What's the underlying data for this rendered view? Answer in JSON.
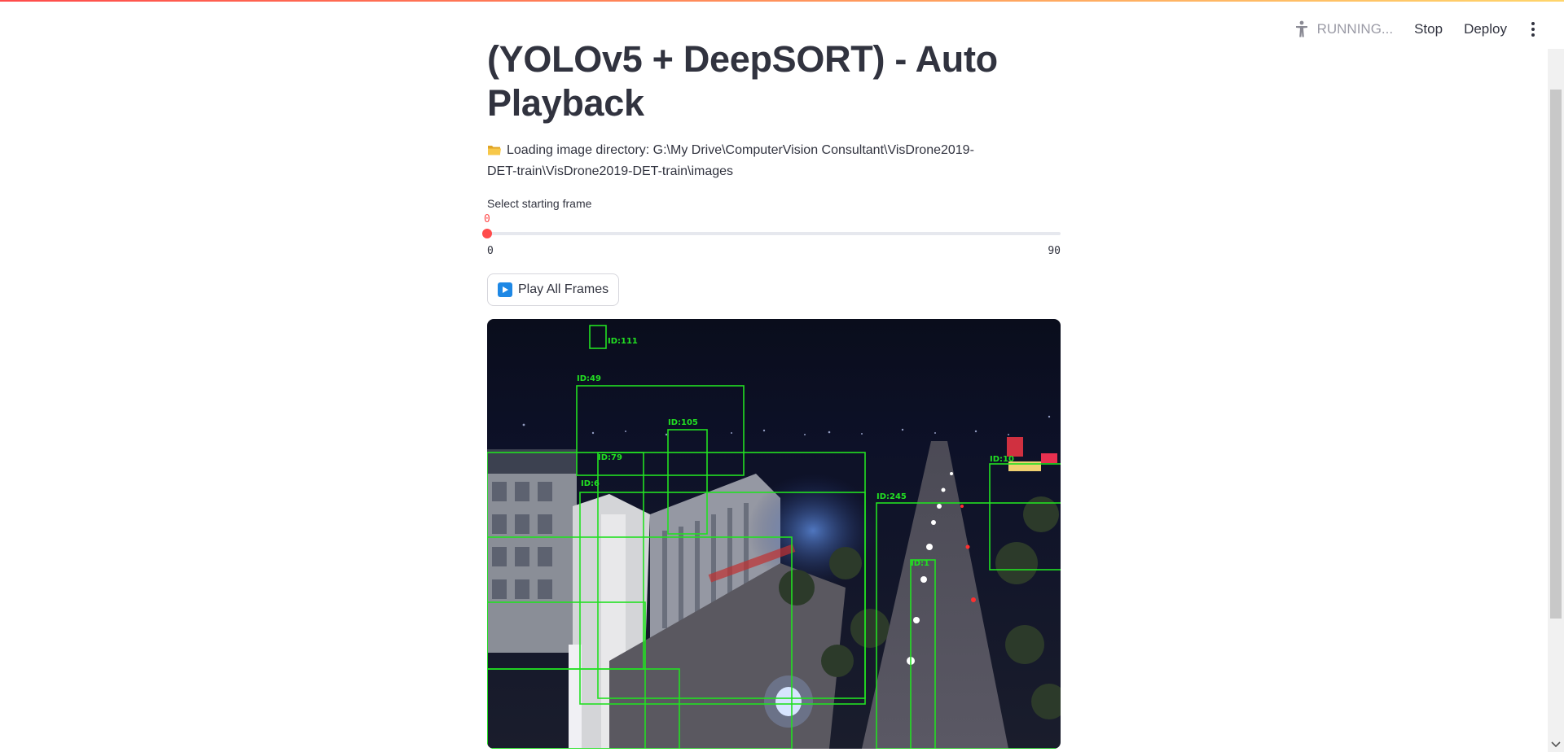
{
  "toolbar": {
    "status": "RUNNING...",
    "stop_label": "Stop",
    "deploy_label": "Deploy"
  },
  "main": {
    "title": "(YOLOv5 + DeepSORT) - Auto Playback",
    "directory_text": "Loading image directory: G:\\My Drive\\ComputerVision Consultant\\VisDrone2019-DET-train\\VisDrone2019-DET-train\\images",
    "slider": {
      "label": "Select starting frame",
      "value": 0,
      "value_label": "0",
      "min_label": "0",
      "max_label": "90",
      "min": 0,
      "max": 90
    },
    "play_button_label": "Play All Frames"
  },
  "detections": [
    {
      "label": "ID:111"
    },
    {
      "label": "ID:49"
    },
    {
      "label": "ID:105"
    },
    {
      "label": "ID:79"
    },
    {
      "label": "ID:6"
    },
    {
      "label": "ID:245"
    },
    {
      "label": "ID:10"
    },
    {
      "label": "ID:1"
    }
  ],
  "colors": {
    "accent": "#ff4b4b",
    "box": "#22e022",
    "play_icon": "#1e88e5"
  }
}
